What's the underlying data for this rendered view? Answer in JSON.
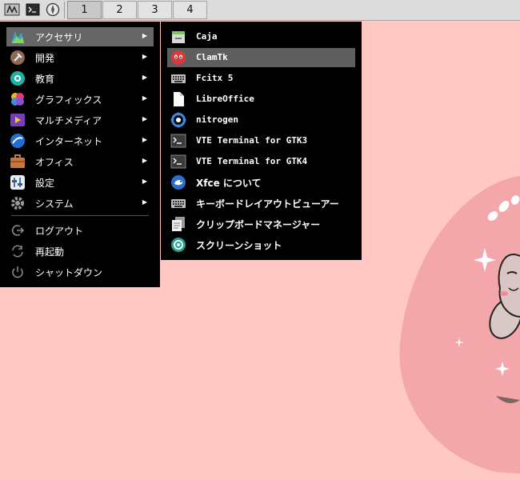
{
  "taskbar": {
    "launchers": [
      {
        "icon": "mascot-icon"
      },
      {
        "icon": "terminal-icon"
      },
      {
        "icon": "browser-icon"
      }
    ],
    "workspaces": [
      {
        "label": "1",
        "active": true
      },
      {
        "label": "2",
        "active": false
      },
      {
        "label": "3",
        "active": false
      },
      {
        "label": "4",
        "active": false
      }
    ]
  },
  "main_menu": {
    "items": [
      {
        "label": "アクセサリ",
        "icon": "accessories-icon",
        "submenu": true,
        "highlighted": true
      },
      {
        "label": "開発",
        "icon": "development-icon",
        "submenu": true
      },
      {
        "label": "教育",
        "icon": "education-icon",
        "submenu": true
      },
      {
        "label": "グラフィックス",
        "icon": "graphics-icon",
        "submenu": true
      },
      {
        "label": "マルチメディア",
        "icon": "multimedia-icon",
        "submenu": true
      },
      {
        "label": "インターネット",
        "icon": "internet-icon",
        "submenu": true
      },
      {
        "label": "オフィス",
        "icon": "office-icon",
        "submenu": true
      },
      {
        "label": "設定",
        "icon": "settings-icon",
        "submenu": true
      },
      {
        "label": "システム",
        "icon": "system-icon",
        "submenu": true
      }
    ],
    "actions": [
      {
        "label": "ログアウト",
        "icon": "logout-icon"
      },
      {
        "label": "再起動",
        "icon": "restart-icon"
      },
      {
        "label": "シャットダウン",
        "icon": "shutdown-icon"
      }
    ],
    "arrow": "▶"
  },
  "submenu": {
    "items": [
      {
        "label": "Caja",
        "icon": "file-manager-icon"
      },
      {
        "label": "ClamTk",
        "icon": "clamtk-icon",
        "highlighted": true
      },
      {
        "label": "Fcitx 5",
        "icon": "keyboard-icon"
      },
      {
        "label": "LibreOffice",
        "icon": "document-icon"
      },
      {
        "label": "nitrogen",
        "icon": "nitrogen-icon"
      },
      {
        "label": "VTE Terminal for GTK3",
        "icon": "terminal-icon"
      },
      {
        "label": "VTE Terminal for GTK4",
        "icon": "terminal-icon"
      },
      {
        "label": "Xfce について",
        "icon": "xfce-icon"
      },
      {
        "label": "キーボードレイアウトビューアー",
        "icon": "keyboard-icon"
      },
      {
        "label": "クリップボードマネージャー",
        "icon": "clipboard-icon"
      },
      {
        "label": "スクリーンショット",
        "icon": "screenshot-icon"
      }
    ]
  },
  "colors": {
    "desktop": "#ffc8c2",
    "menu_bg": "#000000",
    "highlight": "#666666",
    "taskbar": "#dcdcdc"
  }
}
